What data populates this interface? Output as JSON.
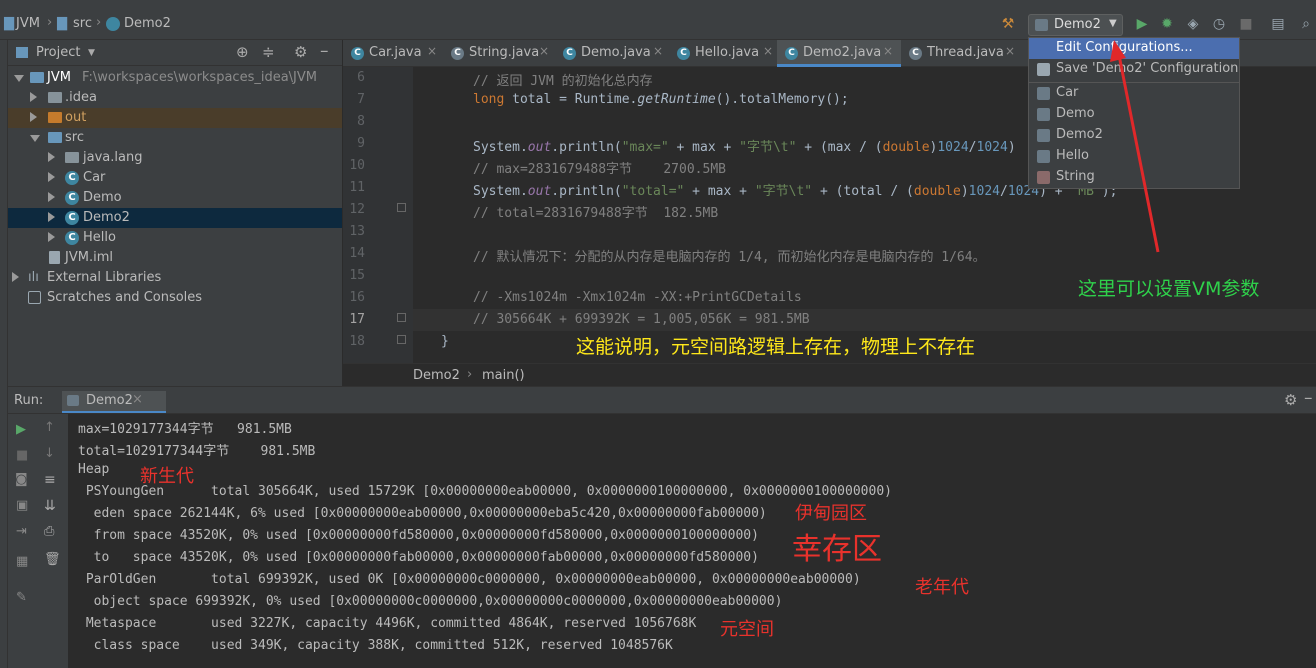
{
  "breadcrumb": {
    "project": "JVM",
    "folder": "src",
    "file": "Demo2"
  },
  "run_config": {
    "selected": "Demo2"
  },
  "project_panel": {
    "title": "Project",
    "tree": [
      {
        "label": "JVM",
        "path": "F:\\workspaces\\workspaces_idea\\JVM",
        "kind": "root"
      },
      {
        "label": ".idea",
        "kind": "folder"
      },
      {
        "label": "out",
        "kind": "folder-orange"
      },
      {
        "label": "src",
        "kind": "folder-blue"
      },
      {
        "label": "java.lang",
        "kind": "package"
      },
      {
        "label": "Car",
        "kind": "class"
      },
      {
        "label": "Demo",
        "kind": "class"
      },
      {
        "label": "Demo2",
        "kind": "class"
      },
      {
        "label": "Hello",
        "kind": "class"
      },
      {
        "label": "JVM.iml",
        "kind": "file"
      },
      {
        "label": "External Libraries",
        "kind": "lib"
      },
      {
        "label": "Scratches and Consoles",
        "kind": "scratch"
      }
    ]
  },
  "tabs": [
    {
      "label": "Car.java"
    },
    {
      "label": "String.java"
    },
    {
      "label": "Demo.java"
    },
    {
      "label": "Hello.java"
    },
    {
      "label": "Demo2.java"
    },
    {
      "label": "Thread.java"
    }
  ],
  "editor": {
    "line_numbers": [
      "6",
      "7",
      "8",
      "9",
      "10",
      "11",
      "12",
      "13",
      "14",
      "15",
      "16",
      "17",
      "18"
    ],
    "code": {
      "l6": "// 返回 JVM 的初始化总内存",
      "l7_kw": "long",
      "l7_a": " total = Runtime.",
      "l7_it": "getRuntime",
      "l7_b": "().totalMemory();",
      "l9_a": "System.",
      "l9_it": "out",
      "l9_b": ".println(",
      "l9_s1": "\"max=\"",
      "l9_c": " + max + ",
      "l9_s2": "\"字节\\t\"",
      "l9_d": " + (max / (",
      "l9_kw": "double",
      "l9_e": ")",
      "l9_n1": "1024",
      "l9_f": "/",
      "l9_n2": "1024",
      "l9_g": ")",
      "l10": "// max=2831679488字节    2700.5MB",
      "l11_a": "System.",
      "l11_it": "out",
      "l11_b": ".println(",
      "l11_s1": "\"total=\"",
      "l11_c": " + max + ",
      "l11_s2": "\"字节\\t\"",
      "l11_d": " + (total / (",
      "l11_kw": "double",
      "l11_e": ")",
      "l11_n1": "1024",
      "l11_f": "/",
      "l11_n2": "1024",
      "l11_g": ") + ",
      "l11_s3": "\"MB\"",
      "l11_h": ");",
      "l12": "// total=2831679488字节  182.5MB",
      "l14": "// 默认情况下：分配的从内存是电脑内存的 1/4, 而初始化内存是电脑内存的 1/64。",
      "l16": "// -Xms1024m -Xmx1024m -XX:+PrintGCDetails",
      "l17": "// 305664K + 699392K = 1,005,056K = 981.5MB",
      "l18": "}"
    },
    "breadcrumb": {
      "cls": "Demo2",
      "method": "main()"
    }
  },
  "run": {
    "label": "Run:",
    "tab": "Demo2",
    "output": [
      "max=1029177344字节   981.5MB",
      "total=1029177344字节    981.5MB",
      "Heap",
      " PSYoungGen      total 305664K, used 15729K [0x00000000eab00000, 0x0000000100000000, 0x0000000100000000)",
      "  eden space 262144K, 6% used [0x00000000eab00000,0x00000000eba5c420,0x00000000fab00000)",
      "  from space 43520K, 0% used [0x00000000fd580000,0x00000000fd580000,0x0000000100000000)",
      "  to   space 43520K, 0% used [0x00000000fab00000,0x00000000fab00000,0x00000000fd580000)",
      " ParOldGen       total 699392K, used 0K [0x00000000c0000000, 0x00000000eab00000, 0x00000000eab00000)",
      "  object space 699392K, 0% used [0x00000000c0000000,0x00000000c0000000,0x00000000eab00000)",
      " Metaspace       used 3227K, capacity 4496K, committed 4864K, reserved 1056768K",
      "  class space    used 349K, capacity 388K, committed 512K, reserved 1048576K"
    ]
  },
  "dropdown": {
    "items": [
      "Edit Configurations...",
      "Save 'Demo2' Configuration",
      "Car",
      "Demo",
      "Demo2",
      "Hello",
      "String"
    ]
  },
  "annotations": {
    "vm_params": "这里可以设置VM参数",
    "metaspace_note": "这能说明，元空间路逻辑上存在，物理上不存在",
    "young": "新生代",
    "eden": "伊甸园区",
    "survivor": "幸存区",
    "old": "老年代",
    "meta": "元空间"
  },
  "colors": {
    "annotation_red": "#e8322c",
    "annotation_green": "#2fd14b",
    "annotation_yellow": "#ffe81a",
    "arrow": "#e0282a"
  }
}
